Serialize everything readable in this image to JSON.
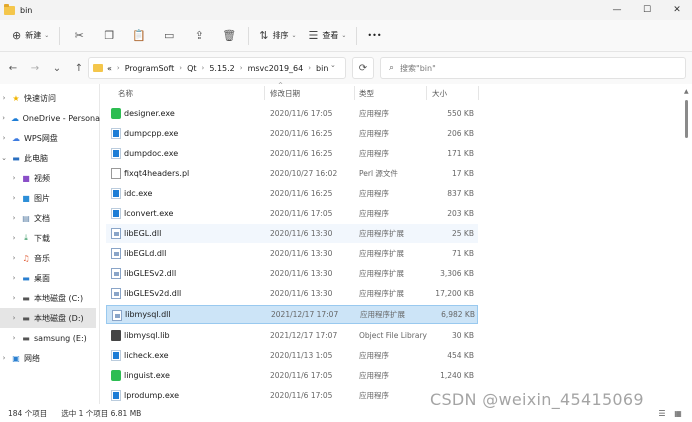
{
  "window": {
    "title": "bin",
    "minimize": "—",
    "maximize": "☐",
    "close": "✕"
  },
  "toolbar": {
    "new_label": "新建",
    "sort_label": "排序",
    "view_label": "查看",
    "more": "•••"
  },
  "address": {
    "overflow": "«",
    "crumbs": [
      "ProgramSoft",
      "Qt",
      "5.15.2",
      "msvc2019_64",
      "bin"
    ],
    "search_placeholder": "搜索\"bin\""
  },
  "sidebar": {
    "items": [
      {
        "label": "快速访问"
      },
      {
        "label": "OneDrive - Persona"
      },
      {
        "label": "WPS网盘"
      },
      {
        "label": "此电脑"
      },
      {
        "label": "视频"
      },
      {
        "label": "图片"
      },
      {
        "label": "文档"
      },
      {
        "label": "下载"
      },
      {
        "label": "音乐"
      },
      {
        "label": "桌面"
      },
      {
        "label": "本地磁盘 (C:)"
      },
      {
        "label": "本地磁盘 (D:)"
      },
      {
        "label": "samsung (E:)"
      },
      {
        "label": "网络"
      }
    ]
  },
  "columns": {
    "name": "名称",
    "date": "修改日期",
    "type": "类型",
    "size": "大小"
  },
  "files": [
    {
      "name": "designer.exe",
      "date": "2020/11/6 17:05",
      "type": "应用程序",
      "size": "550 KB",
      "icon": "green-app-icon"
    },
    {
      "name": "dumpcpp.exe",
      "date": "2020/11/6 16:25",
      "type": "应用程序",
      "size": "206 KB",
      "icon": "app-icon"
    },
    {
      "name": "dumpdoc.exe",
      "date": "2020/11/6 16:25",
      "type": "应用程序",
      "size": "171 KB",
      "icon": "app-icon"
    },
    {
      "name": "fixqt4headers.pl",
      "date": "2020/10/27 16:02",
      "type": "Perl 源文件",
      "size": "17 KB",
      "icon": "document-icon"
    },
    {
      "name": "idc.exe",
      "date": "2020/11/6 16:25",
      "type": "应用程序",
      "size": "837 KB",
      "icon": "app-icon"
    },
    {
      "name": "lconvert.exe",
      "date": "2020/11/6 17:05",
      "type": "应用程序",
      "size": "203 KB",
      "icon": "app-icon"
    },
    {
      "name": "libEGL.dll",
      "date": "2020/11/6 13:30",
      "type": "应用程序扩展",
      "size": "25 KB",
      "icon": "dll-icon"
    },
    {
      "name": "libEGLd.dll",
      "date": "2020/11/6 13:30",
      "type": "应用程序扩展",
      "size": "71 KB",
      "icon": "dll-icon"
    },
    {
      "name": "libGLESv2.dll",
      "date": "2020/11/6 13:30",
      "type": "应用程序扩展",
      "size": "3,306 KB",
      "icon": "dll-icon"
    },
    {
      "name": "libGLESv2d.dll",
      "date": "2020/11/6 13:30",
      "type": "应用程序扩展",
      "size": "17,200 KB",
      "icon": "dll-icon"
    },
    {
      "name": "libmysql.dll",
      "date": "2021/12/17 17:07",
      "type": "应用程序扩展",
      "size": "6,982 KB",
      "icon": "dll-icon"
    },
    {
      "name": "libmysql.lib",
      "date": "2021/12/17 17:07",
      "type": "Object File Library",
      "size": "30 KB",
      "icon": "library-icon"
    },
    {
      "name": "licheck.exe",
      "date": "2020/11/13 1:05",
      "type": "应用程序",
      "size": "454 KB",
      "icon": "app-icon"
    },
    {
      "name": "linguist.exe",
      "date": "2020/11/6 17:05",
      "type": "应用程序",
      "size": "1,240 KB",
      "icon": "green-app-icon"
    },
    {
      "name": "lprodump.exe",
      "date": "2020/11/6 17:05",
      "type": "应用程序",
      "size": "",
      "icon": "app-icon"
    }
  ],
  "status": {
    "count": "184 个项目",
    "selected": "选中 1 个项目  6.81 MB"
  },
  "watermark": "CSDN @weixin_45415069",
  "colors": {
    "selection": "#cce4f7",
    "hover": "#f2f7fd",
    "accent": "#0067c0"
  }
}
